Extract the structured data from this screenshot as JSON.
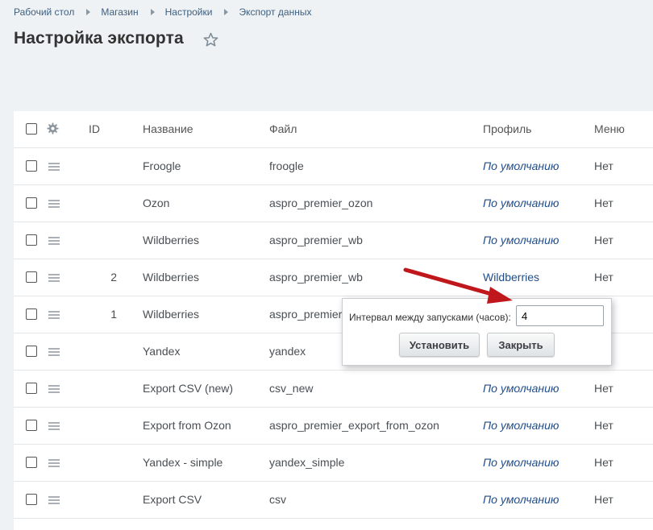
{
  "breadcrumb": [
    "Рабочий стол",
    "Магазин",
    "Настройки",
    "Экспорт данных"
  ],
  "page": {
    "title": "Настройка экспорта"
  },
  "table": {
    "headers": {
      "id": "ID",
      "name": "Название",
      "file": "Файл",
      "profile": "Профиль",
      "menu": "Меню"
    },
    "rows": [
      {
        "id": "",
        "name": "Froogle",
        "file": "froogle",
        "profile": "По умолчанию",
        "menu": "Нет"
      },
      {
        "id": "",
        "name": "Ozon",
        "file": "aspro_premier_ozon",
        "profile": "По умолчанию",
        "menu": "Нет"
      },
      {
        "id": "",
        "name": "Wildberries",
        "file": "aspro_premier_wb",
        "profile": "По умолчанию",
        "menu": "Нет"
      },
      {
        "id": "2",
        "name": "Wildberries",
        "file": "aspro_premier_wb",
        "profile": "Wildberries",
        "menu": "Нет"
      },
      {
        "id": "1",
        "name": "Wildberries",
        "file": "aspro_premier",
        "profile": "",
        "menu": ""
      },
      {
        "id": "",
        "name": "Yandex",
        "file": "yandex",
        "profile": "",
        "menu": ""
      },
      {
        "id": "",
        "name": "Export CSV (new)",
        "file": "csv_new",
        "profile": "По умолчанию",
        "menu": "Нет"
      },
      {
        "id": "",
        "name": "Export from Ozon",
        "file": "aspro_premier_export_from_ozon",
        "profile": "По умолчанию",
        "menu": "Нет"
      },
      {
        "id": "",
        "name": "Yandex - simple",
        "file": "yandex_simple",
        "profile": "По умолчанию",
        "menu": "Нет"
      },
      {
        "id": "",
        "name": "Export CSV",
        "file": "csv",
        "profile": "По умолчанию",
        "menu": "Нет"
      }
    ]
  },
  "popup": {
    "label": "Интервал между запусками (часов):",
    "value": "4",
    "set_button": "Установить",
    "close_button": "Закрыть"
  },
  "colors": {
    "link": "#1f4d8c",
    "arrow": "#c0171c",
    "background": "#eef2f4"
  },
  "icons": {
    "favorite": "star-icon",
    "settings": "gear-icon",
    "drag": "drag-handle-icon"
  }
}
